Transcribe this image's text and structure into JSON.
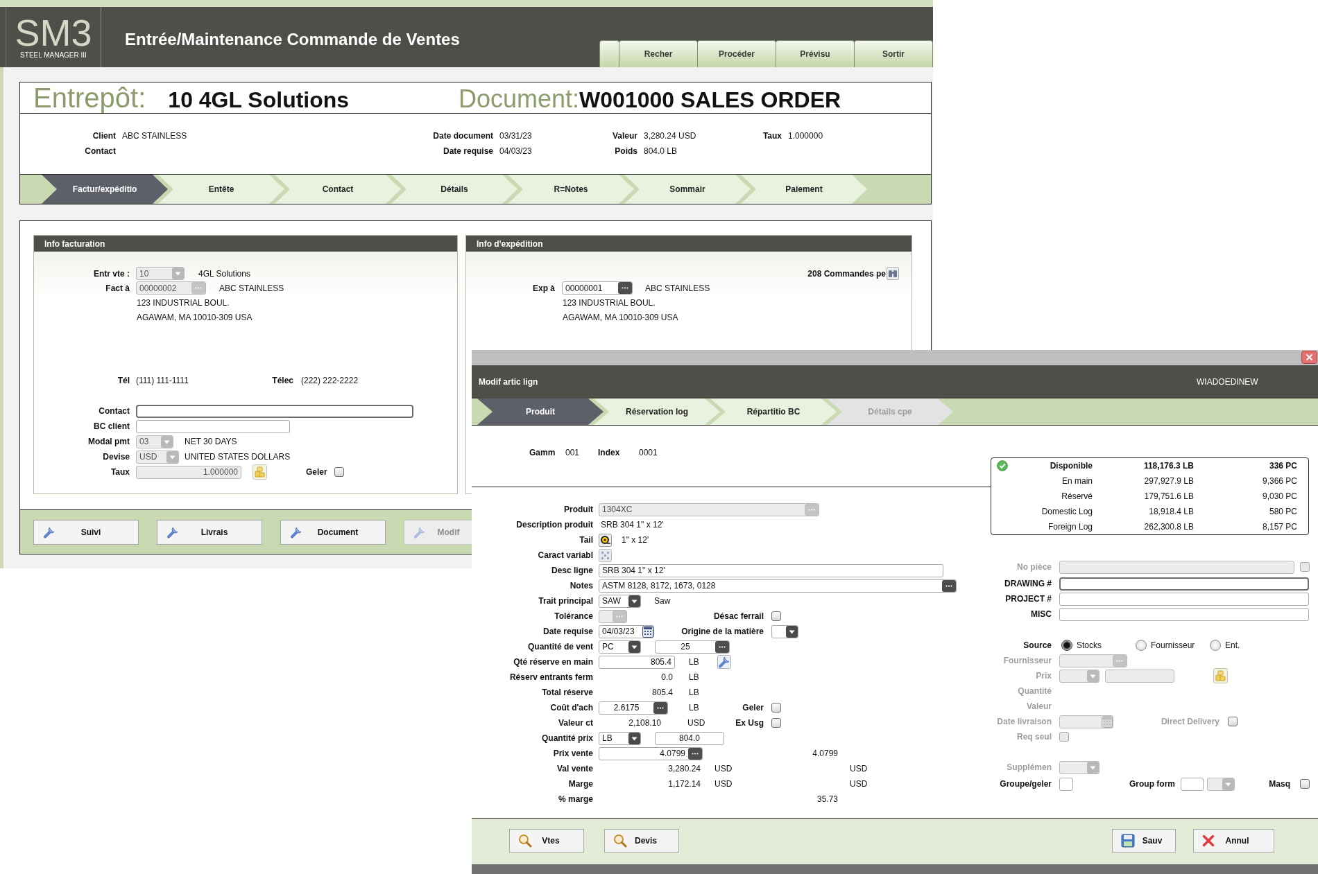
{
  "window": {
    "logo": "SM3",
    "logo_subtitle": "STEEL MANAGER III",
    "title": "Entrée/Maintenance Commande de Ventes",
    "toolbar": [
      {
        "label": "Recher"
      },
      {
        "label": "Procéder"
      },
      {
        "label": "Prévisu"
      },
      {
        "label": "Sortir"
      }
    ]
  },
  "order": {
    "warehouse_label": "Entrepôt:",
    "warehouse": "10 4GL Solutions",
    "document_label": "Document:",
    "document": "W001000 SALES ORDER",
    "info": [
      [
        {
          "label": "Client",
          "value": "ABC STAINLESS"
        },
        {
          "label": "Contact"
        }
      ],
      [
        {
          "label": "Date document",
          "value": "03/31/23"
        },
        {
          "label": "Date requise",
          "value": "04/03/23"
        }
      ],
      [
        {
          "label": "Valeur",
          "value": "3,280.24 USD"
        },
        {
          "label": "Poids",
          "value": "804.0 LB"
        }
      ],
      [
        {
          "label": "Taux",
          "value": "1.000000"
        }
      ]
    ],
    "steps": [
      {
        "label": "Factur/expéditio",
        "selected": true
      },
      {
        "label": "Entête",
        "selected": false
      },
      {
        "label": "Contact",
        "selected": false
      },
      {
        "label": "Détails",
        "selected": false
      },
      {
        "label": "R=Notes",
        "selected": false
      },
      {
        "label": "Sommair",
        "selected": false
      },
      {
        "label": "Paiement",
        "selected": false
      }
    ]
  },
  "billing": {
    "title": "Info facturation",
    "company": {
      "label": "Entr vte :",
      "value": "10",
      "name": "4GL Solutions",
      "disabled": true
    },
    "bill_to": {
      "label": "Fact à",
      "value": "00000002",
      "name": "ABC STAINLESS",
      "disabled": true
    },
    "address": [
      "123 INDUSTRIAL BOUL.",
      "AGAWAM, MA 10010-309 USA"
    ],
    "phone": {
      "label": "Tél",
      "value": "(111) 111-1111"
    },
    "fax": {
      "label": "Télec",
      "value": "(222) 222-2222"
    },
    "contact": {
      "label": "Contact",
      "focused": true
    },
    "customer_po": {
      "label": "BC client",
      "focused": false
    },
    "terms": {
      "label": "Modal pmt",
      "value": "03",
      "name": "NET 30 DAYS",
      "disabled": true
    },
    "currency": {
      "label": "Devise",
      "value": "USD",
      "name": "UNITED STATES DOLLARS",
      "disabled": true
    },
    "rate": {
      "label": "Taux",
      "value": "1.000000",
      "disabled": true
    },
    "freeze": {
      "label": "Geler",
      "checked": false
    }
  },
  "shipping": {
    "title": "Info d'expédition",
    "orders": "208 Commandes pe",
    "ship_to": {
      "label": "Exp à",
      "value": "00000001",
      "name": "ABC STAINLESS",
      "disabled": false
    },
    "address": [
      "123 INDUSTRIAL BOUL.",
      "AGAWAM, MA 10010-309 USA"
    ]
  },
  "actions": [
    {
      "label": "Suivi",
      "disabled": false
    },
    {
      "label": "Livrais",
      "disabled": false
    },
    {
      "label": "Document",
      "disabled": false
    },
    {
      "label": "Modif",
      "disabled": true
    }
  ],
  "dialog": {
    "title": "Modif artic lign",
    "user": "WIADOEDINEW",
    "tabs": [
      {
        "label": "Produit",
        "selected": true,
        "disabled": false
      },
      {
        "label": "Réservation log",
        "selected": false,
        "disabled": false
      },
      {
        "label": "Répartitio BC",
        "selected": false,
        "disabled": false
      },
      {
        "label": "Détails cpe",
        "selected": false,
        "disabled": true
      }
    ],
    "range": {
      "label": "Gamm",
      "value": "001"
    },
    "index": {
      "label": "Index",
      "value": "0001"
    },
    "stock": [
      {
        "kind": "summary",
        "label": "Disponible",
        "weight": "118,176.3 LB",
        "pieces": "336 PC"
      },
      {
        "kind": "detail",
        "label": "En main",
        "weight": "297,927.9 LB",
        "pieces": "9,366 PC"
      },
      {
        "kind": "detail",
        "label": "Réservé",
        "weight": "179,751.6 LB",
        "pieces": "9,030 PC"
      },
      {
        "kind": "detail",
        "label": "Domestic Log",
        "weight": "18,918.4 LB",
        "pieces": "580 PC"
      },
      {
        "kind": "detail",
        "label": "Foreign Log",
        "weight": "262,300.8 LB",
        "pieces": "8,157 PC"
      }
    ],
    "form": {
      "product": {
        "label": "Produit",
        "value": "1304XC",
        "disabled": true
      },
      "description": {
        "label": "Description produit",
        "value": "SRB 304 1\" x 12'"
      },
      "size": {
        "label": "Tail",
        "value": "1\" x 12'"
      },
      "attributes": {
        "label": "Caract variabl"
      },
      "line_description": {
        "label": "Desc ligne",
        "value": "SRB 304 1\" x 12'"
      },
      "notes": {
        "label": "Notes",
        "value": "ASTM 8128, 8172, 1673, 0128"
      },
      "process": {
        "label": "Trait principal",
        "value": "SAW",
        "name": "Saw"
      },
      "tolerance": {
        "label": "Tolérance",
        "disabled": true
      },
      "scrap": {
        "label": "Désac ferrail",
        "checked": false
      },
      "required_date": {
        "label": "Date requise",
        "value": "04/03/23"
      },
      "origin": {
        "label": "Origine de la matière"
      },
      "sales_qty": {
        "label": "Quantité de vent",
        "unit": "PC",
        "value": "25"
      },
      "reserved_on_hand": {
        "label": "Qté réserve en main",
        "value": "805.4",
        "unit": "LB"
      },
      "reserved_incoming": {
        "label": "Réserv entrants ferm",
        "value": "0.0",
        "unit": "LB"
      },
      "reserved_total": {
        "label": "Total réserve",
        "value": "805.4",
        "unit": "LB"
      },
      "cost": {
        "label": "Coût d'ach",
        "value": "2.6175",
        "unit": "LB"
      },
      "freeze": {
        "label": "Geler",
        "checked": false
      },
      "cost_value": {
        "label": "Valeur ct",
        "value": "2,108.10",
        "currency": "USD"
      },
      "ex_usage": {
        "label": "Ex Usg",
        "checked": false
      },
      "price_qty": {
        "label": "Quantité prix",
        "unit": "LB",
        "value": "804.0"
      },
      "price": {
        "label": "Prix vente",
        "value": "4.0799",
        "column_2": "4.0799"
      },
      "sale_value": {
        "label": "Val vente",
        "value": "3,280.24",
        "currency": "USD",
        "column_2_currency": "USD"
      },
      "margin": {
        "label": "Marge",
        "value": "1,172.14",
        "currency": "USD",
        "column_2_currency": "USD"
      },
      "margin_pct": {
        "label": "% marge",
        "column_2": "35.73"
      }
    },
    "side": {
      "part_no": {
        "label": "No pièce",
        "disabled": true,
        "checked": false
      },
      "custom_fields": [
        {
          "label": "DRAWING #",
          "focused": true
        },
        {
          "label": "PROJECT #",
          "focused": false
        },
        {
          "label": "MISC",
          "focused": false
        }
      ],
      "source": {
        "label": "Source",
        "options": [
          {
            "label": "Stocks",
            "selected": true
          },
          {
            "label": "Fournisseur",
            "selected": false
          },
          {
            "label": "Ent.",
            "selected": false
          }
        ]
      },
      "supplier": {
        "label": "Fournisseur",
        "disabled": true
      },
      "supplier_price": {
        "label": "Prix",
        "disabled": true
      },
      "supplier_qty": {
        "label": "Quantité",
        "disabled": true
      },
      "supplier_value": {
        "label": "Valeur",
        "disabled": true
      },
      "delivery_date": {
        "label": "Date livraison",
        "disabled": true
      },
      "direct_delivery": {
        "label": "Direct Delivery",
        "disabled": true,
        "checked": false
      },
      "request_only": {
        "label": "Req seul",
        "disabled": true,
        "checked": false
      },
      "surcharge": {
        "label": "Supplémen",
        "disabled": true
      },
      "group_freeze": {
        "label": "Groupe/geler"
      },
      "group_form": {
        "label": "Group form"
      },
      "hide": {
        "label": "Masq",
        "checked": false
      }
    },
    "tools": [
      {
        "label": "Vtes"
      },
      {
        "label": "Devis"
      }
    ],
    "commands": [
      {
        "label": "Sauv",
        "kind": "save"
      },
      {
        "label": "Annul",
        "kind": "cancel"
      }
    ]
  }
}
